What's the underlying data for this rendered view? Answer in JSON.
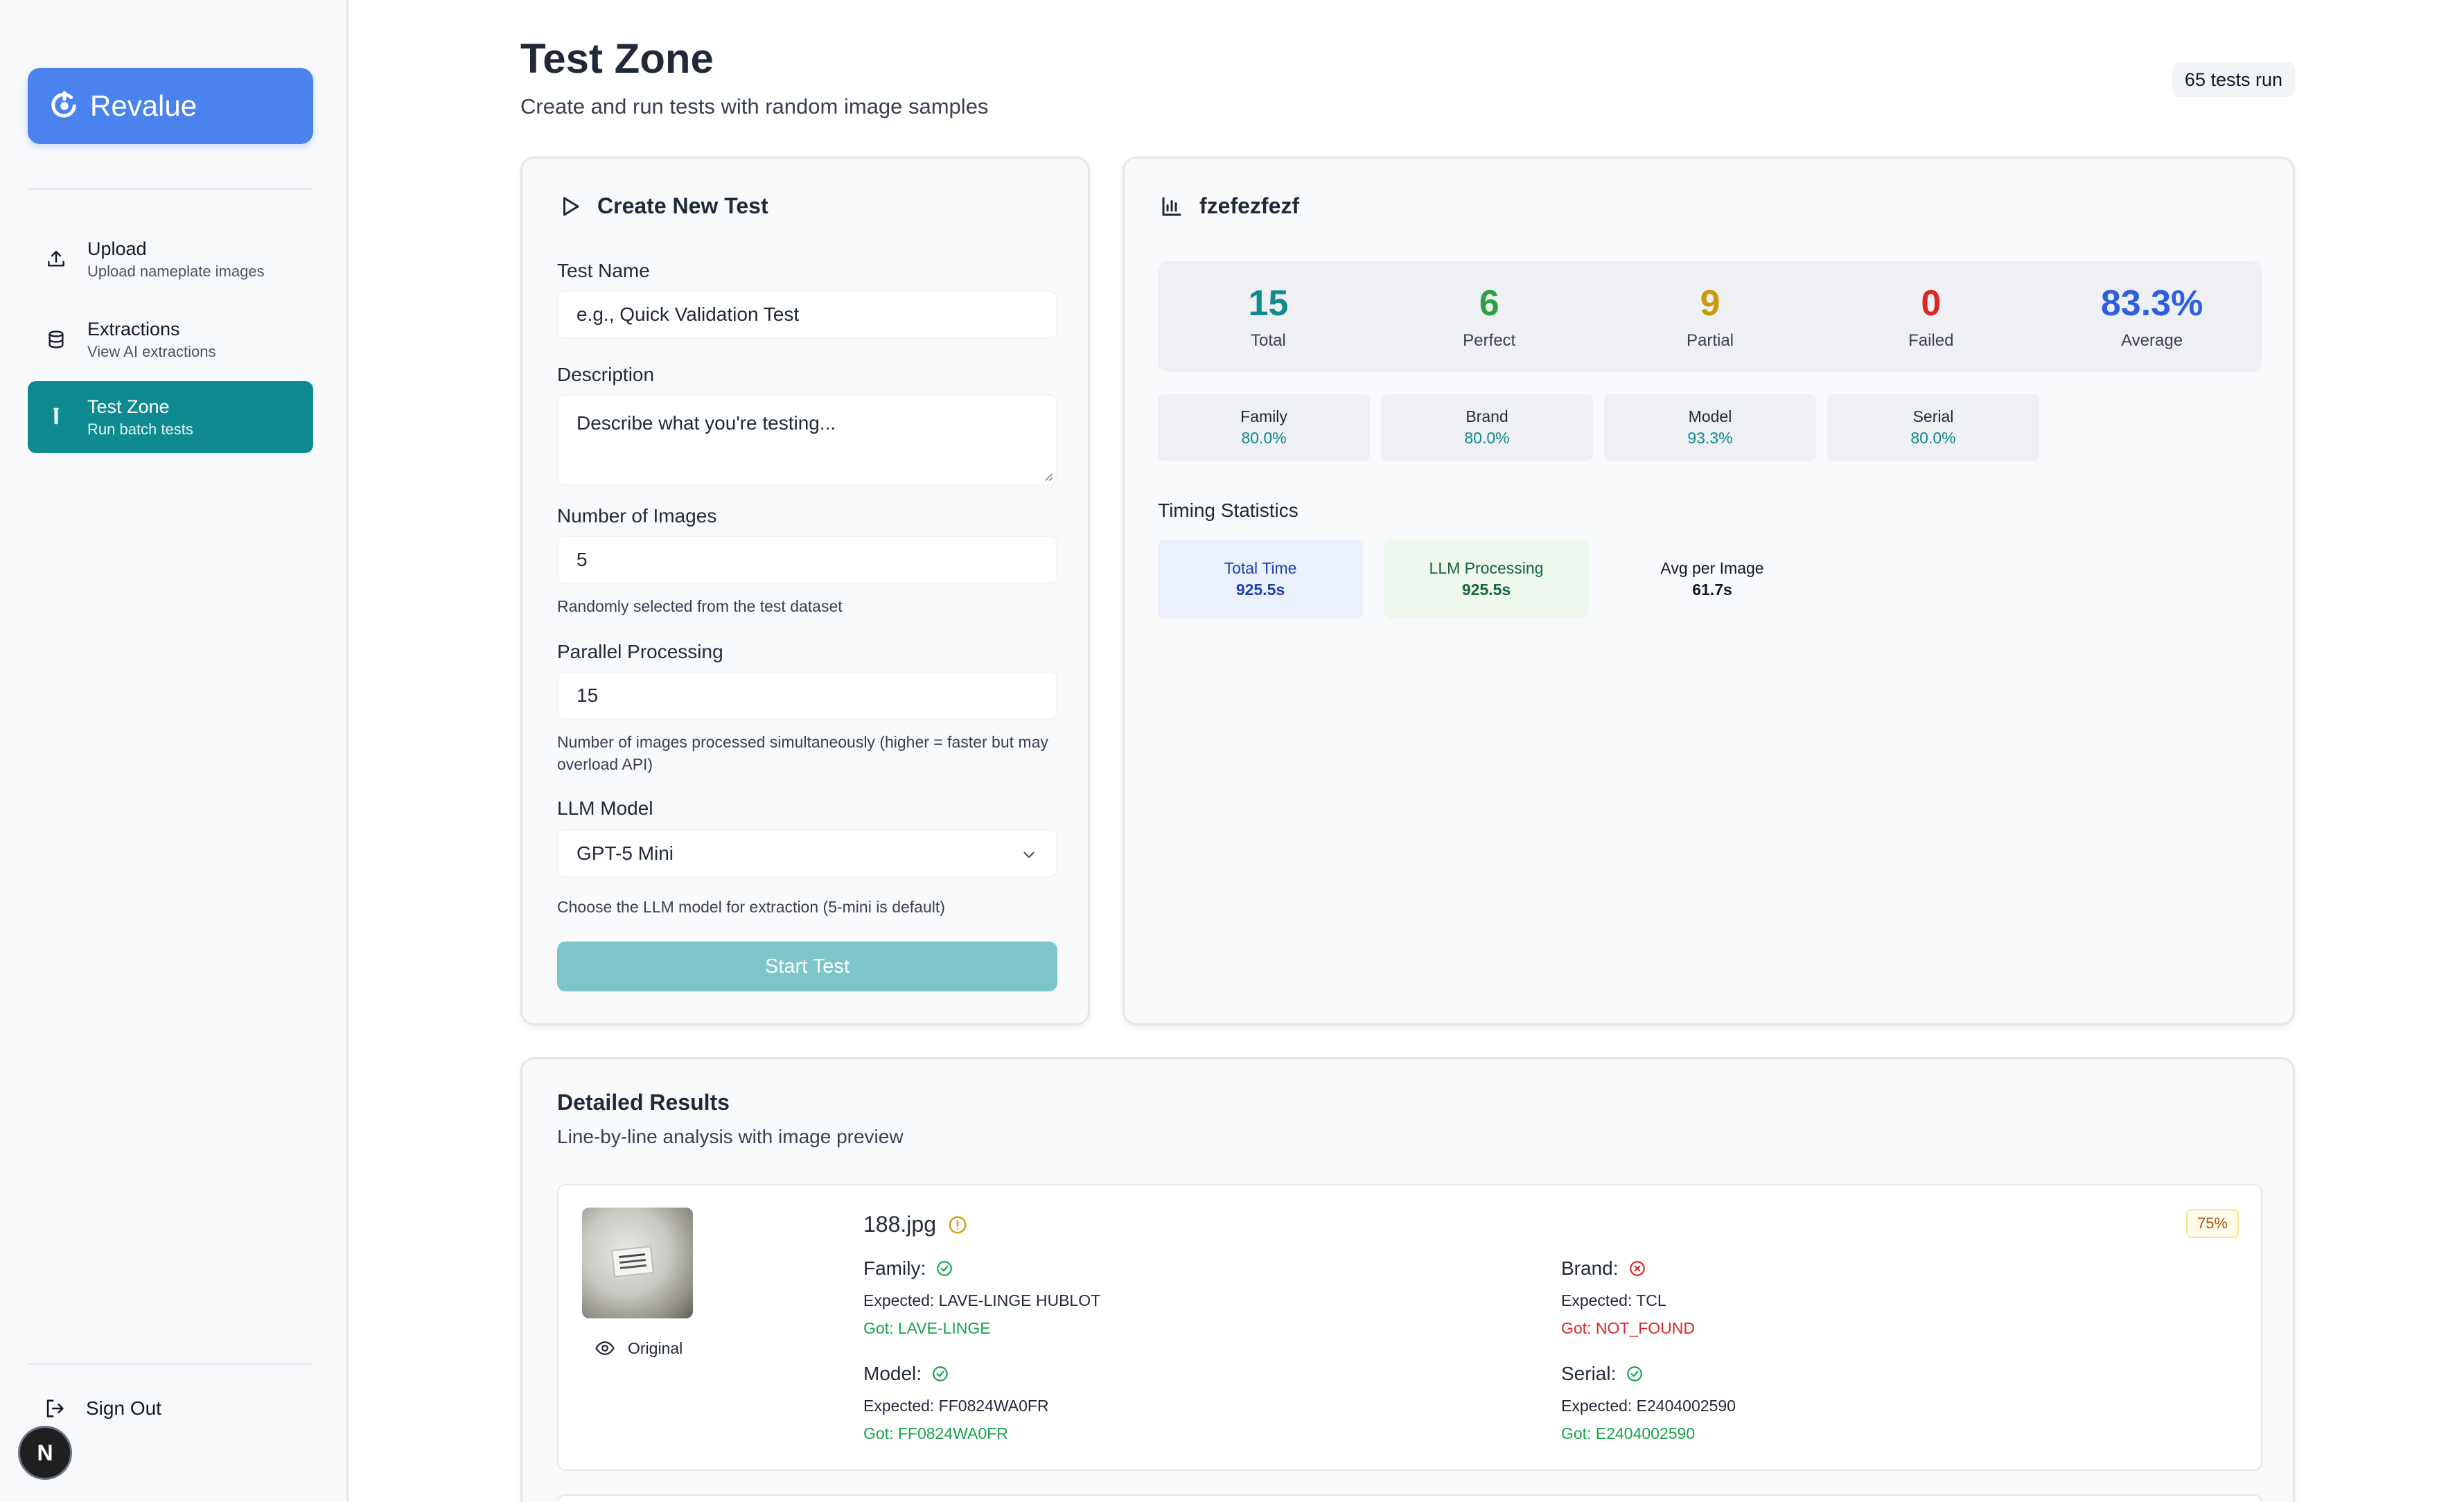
{
  "sidebar": {
    "brand": "Revalue",
    "items": [
      {
        "title": "Upload",
        "subtitle": "Upload nameplate images"
      },
      {
        "title": "Extractions",
        "subtitle": "View AI extractions"
      },
      {
        "title": "Test Zone",
        "subtitle": "Run batch tests"
      }
    ],
    "sign_out": "Sign Out",
    "avatar_letter": "N"
  },
  "header": {
    "title": "Test Zone",
    "subtitle": "Create and run tests with random image samples",
    "tests_run": "65 tests run"
  },
  "create": {
    "title": "Create New Test",
    "test_name_label": "Test Name",
    "test_name_placeholder": "e.g., Quick Validation Test",
    "description_label": "Description",
    "description_placeholder": "Describe what you're testing...",
    "num_images_label": "Number of Images",
    "num_images_value": "5",
    "num_images_help": "Randomly selected from the test dataset",
    "parallel_label": "Parallel Processing",
    "parallel_value": "15",
    "parallel_help": "Number of images processed simultaneously (higher = faster but may overload API)",
    "llm_label": "LLM Model",
    "llm_value": "GPT-5 Mini",
    "llm_help": "Choose the LLM model for extraction (5-mini is default)",
    "start_button": "Start Test"
  },
  "results": {
    "title": "fzefezfezf",
    "stats": [
      {
        "value": "15",
        "label": "Total",
        "color": "#0e8a90"
      },
      {
        "value": "6",
        "label": "Perfect",
        "color": "#2f9e44"
      },
      {
        "value": "9",
        "label": "Partial",
        "color": "#c99a06"
      },
      {
        "value": "0",
        "label": "Failed",
        "color": "#dc2626"
      },
      {
        "value": "83.3%",
        "label": "Average",
        "color": "#2f5fe0"
      }
    ],
    "accuracy": [
      {
        "label": "Family",
        "value": "80.0%"
      },
      {
        "label": "Brand",
        "value": "80.0%"
      },
      {
        "label": "Model",
        "value": "93.3%"
      },
      {
        "label": "Serial",
        "value": "80.0%"
      }
    ],
    "timing_title": "Timing Statistics",
    "timing": [
      {
        "label": "Total Time",
        "value": "925.5s"
      },
      {
        "label": "LLM Processing",
        "value": "925.5s"
      },
      {
        "label": "Avg per Image",
        "value": "61.7s"
      }
    ]
  },
  "detail": {
    "title": "Detailed Results",
    "subtitle": "Line-by-line analysis with image preview",
    "item": {
      "file": "188.jpg",
      "score": "75%",
      "original_label": "Original",
      "fields": [
        {
          "name": "Family:",
          "expected": "Expected: LAVE-LINGE HUBLOT",
          "got": "Got: LAVE-LINGE",
          "status": "ok"
        },
        {
          "name": "Brand:",
          "expected": "Expected: TCL",
          "got": "Got: NOT_FOUND",
          "status": "bad"
        },
        {
          "name": "Model:",
          "expected": "Expected: FF0824WA0FR",
          "got": "Got: FF0824WA0FR",
          "status": "ok"
        },
        {
          "name": "Serial:",
          "expected": "Expected: E2404002590",
          "got": "Got: E2404002590",
          "status": "ok"
        }
      ]
    }
  }
}
